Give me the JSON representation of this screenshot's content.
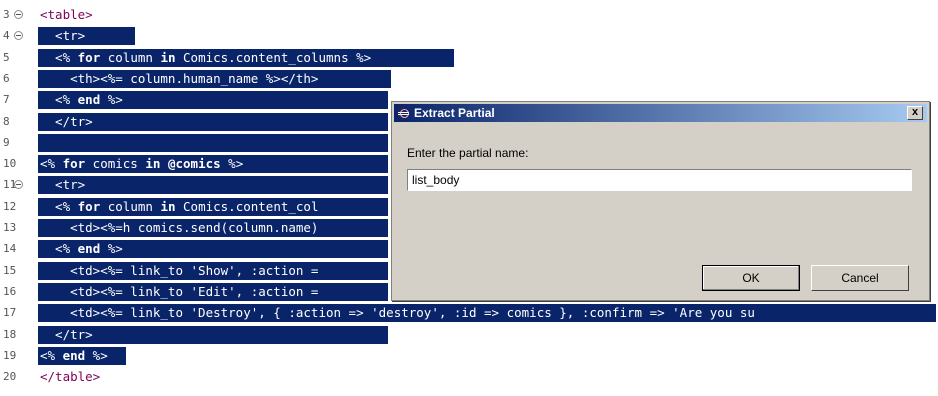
{
  "editor": {
    "lines": [
      {
        "num": "3",
        "fold": true,
        "code": "<table>",
        "selected": false
      },
      {
        "num": "4",
        "fold": true,
        "code": "  <tr>",
        "selected": true
      },
      {
        "num": "5",
        "fold": false,
        "code": "  <% for column in Comics.content_columns %>",
        "selected": true
      },
      {
        "num": "6",
        "fold": false,
        "code": "    <th><%= column.human_name %></th>",
        "selected": true
      },
      {
        "num": "7",
        "fold": false,
        "code": "  <% end %>",
        "selected": true
      },
      {
        "num": "8",
        "fold": false,
        "code": "  </tr>",
        "selected": true
      },
      {
        "num": "9",
        "fold": false,
        "code": "",
        "selected": true
      },
      {
        "num": "10",
        "fold": false,
        "code": "<% for comics in @comics %>",
        "selected": true
      },
      {
        "num": "11",
        "fold": true,
        "code": "  <tr>",
        "selected": true
      },
      {
        "num": "12",
        "fold": false,
        "code": "  <% for column in Comics.content_col",
        "selected": true
      },
      {
        "num": "13",
        "fold": false,
        "code": "    <td><%=h comics.send(column.name)",
        "selected": true
      },
      {
        "num": "14",
        "fold": false,
        "code": "  <% end %>",
        "selected": true
      },
      {
        "num": "15",
        "fold": false,
        "code": "    <td><%= link_to 'Show', :action =",
        "selected": true
      },
      {
        "num": "16",
        "fold": false,
        "code": "    <td><%= link_to 'Edit', :action =",
        "selected": true
      },
      {
        "num": "17",
        "fold": false,
        "code": "    <td><%= link_to 'Destroy', { :action => 'destroy', :id => comics }, :confirm => 'Are you su",
        "selected": true
      },
      {
        "num": "18",
        "fold": false,
        "code": "  </tr>",
        "selected": true
      },
      {
        "num": "19",
        "fold": false,
        "code": "<% end %>",
        "selected": true
      },
      {
        "num": "20",
        "fold": false,
        "code": "</table>",
        "selected": false
      }
    ]
  },
  "dialog": {
    "title": "Extract Partial",
    "close_label": "x",
    "prompt": "Enter the partial name:",
    "input_value": "list_body",
    "ok_label": "OK",
    "cancel_label": "Cancel"
  },
  "colors": {
    "selection": "#0a246a",
    "dialog_bg": "#d4d0c8",
    "title_gradient_start": "#0a246a",
    "title_gradient_end": "#a6caf0"
  }
}
